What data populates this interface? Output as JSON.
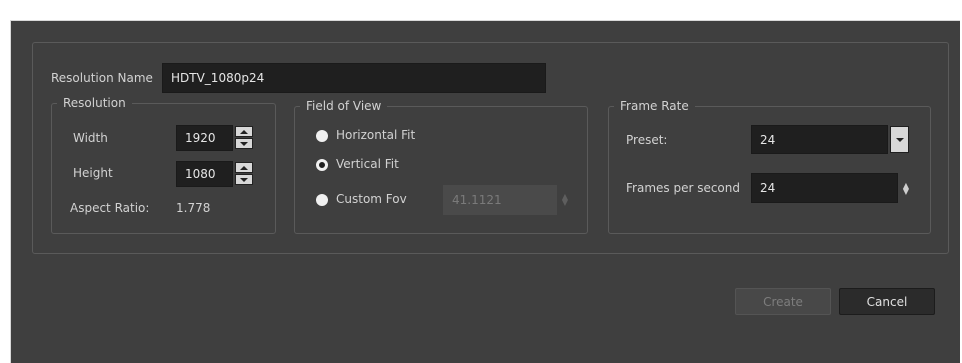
{
  "resolution_name": {
    "label": "Resolution Name",
    "value": "HDTV_1080p24"
  },
  "resolution": {
    "title": "Resolution",
    "width_label": "Width",
    "width_value": "1920",
    "height_label": "Height",
    "height_value": "1080",
    "aspect_label": "Aspect Ratio:",
    "aspect_value": "1.778"
  },
  "field_of_view": {
    "title": "Field of View",
    "options": [
      {
        "label": "Horizontal Fit",
        "selected": false
      },
      {
        "label": "Vertical Fit",
        "selected": true
      },
      {
        "label": "Custom Fov",
        "selected": false
      }
    ],
    "custom_fov_value": "41.1121"
  },
  "frame_rate": {
    "title": "Frame Rate",
    "preset_label": "Preset:",
    "preset_value": "24",
    "fps_label": "Frames per second",
    "fps_value": "24"
  },
  "buttons": {
    "create": "Create",
    "cancel": "Cancel"
  },
  "colors": {
    "background": "#3f3f3f",
    "field": "#1f1f1f",
    "border": "#5a5a5a"
  }
}
